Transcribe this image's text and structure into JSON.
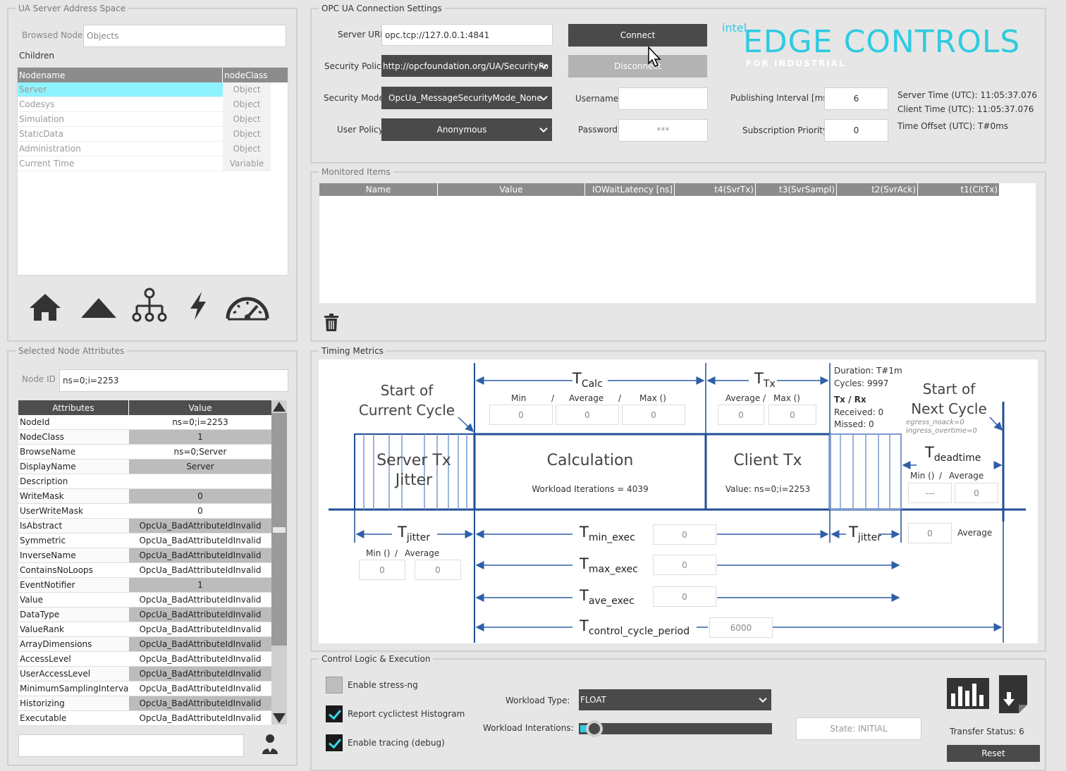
{
  "address_space": {
    "title": "UA Server Address Space",
    "browsed_node_label": "Browsed Node",
    "browsed_node_value": "Objects",
    "children_label": "Children",
    "columns": [
      "Nodename",
      "nodeClass"
    ],
    "rows": [
      {
        "name": "Server",
        "cls": "Object"
      },
      {
        "name": "Codesys",
        "cls": "Object"
      },
      {
        "name": "Simulation",
        "cls": "Object"
      },
      {
        "name": "StaticData",
        "cls": "Object"
      },
      {
        "name": "Administration",
        "cls": "Object"
      },
      {
        "name": "Current Time",
        "cls": "Variable"
      }
    ]
  },
  "attributes": {
    "title": "Selected Node Attributes",
    "node_id_label": "Node ID",
    "node_id_value": "ns=0;i=2253",
    "columns": [
      "Attributes",
      "Value"
    ],
    "rows": [
      {
        "k": "NodeId",
        "v": "ns=0;i=2253"
      },
      {
        "k": "NodeClass",
        "v": "1"
      },
      {
        "k": "BrowseName",
        "v": "ns=0;Server"
      },
      {
        "k": "DisplayName",
        "v": "Server"
      },
      {
        "k": "Description",
        "v": ""
      },
      {
        "k": "WriteMask",
        "v": "0"
      },
      {
        "k": "UserWriteMask",
        "v": "0"
      },
      {
        "k": "IsAbstract",
        "v": "OpcUa_BadAttributeIdInvalid"
      },
      {
        "k": "Symmetric",
        "v": "OpcUa_BadAttributeIdInvalid"
      },
      {
        "k": "InverseName",
        "v": "OpcUa_BadAttributeIdInvalid"
      },
      {
        "k": "ContainsNoLoops",
        "v": "OpcUa_BadAttributeIdInvalid"
      },
      {
        "k": "EventNotifier",
        "v": "1"
      },
      {
        "k": "Value",
        "v": "OpcUa_BadAttributeIdInvalid"
      },
      {
        "k": "DataType",
        "v": "OpcUa_BadAttributeIdInvalid"
      },
      {
        "k": "ValueRank",
        "v": "OpcUa_BadAttributeIdInvalid"
      },
      {
        "k": "ArrayDimensions",
        "v": "OpcUa_BadAttributeIdInvalid"
      },
      {
        "k": "AccessLevel",
        "v": "OpcUa_BadAttributeIdInvalid"
      },
      {
        "k": "UserAccessLevel",
        "v": "OpcUa_BadAttributeIdInvalid"
      },
      {
        "k": "MinimumSamplingInterval",
        "v": "OpcUa_BadAttributeIdInvalid"
      },
      {
        "k": "Historizing",
        "v": "OpcUa_BadAttributeIdInvalid"
      },
      {
        "k": "Executable",
        "v": "OpcUa_BadAttributeIdInvalid"
      }
    ]
  },
  "connection": {
    "title": "OPC UA Connection Settings",
    "server_url_label": "Server URL",
    "server_url": "opc.tcp://127.0.0.1:4841",
    "security_policy_label": "Security Policy",
    "security_policy": "http://opcfoundation.org/UA/SecurityPo",
    "security_mode_label": "Security Mode",
    "security_mode": "OpcUa_MessageSecurityMode_None",
    "user_policy_label": "User Policy",
    "user_policy": "Anonymous",
    "connect_label": "Connect",
    "disconnect_label": "Disconnect",
    "username_label": "Username",
    "username": "",
    "password_label": "Password",
    "password": "***",
    "publishing_interval_label": "Publishing Interval [ms]",
    "publishing_interval": "6",
    "subscription_priority_label": "Subscription Priority",
    "subscription_priority": "0",
    "server_time": "Server Time (UTC): 11:05:37.076",
    "client_time": "Client Time (UTC): 11:05:37.076",
    "time_offset": "Time Offset (UTC): T#0ms",
    "logo_intel": "intel",
    "logo_main": "EDGE CONTROLS",
    "logo_sub": "FOR INDUSTRIAL",
    "accent": "#2ecbe0"
  },
  "monitored": {
    "title": "Monitored Items",
    "columns": [
      "Name",
      "Value",
      "IOWaitLatency [ns]",
      "t4(SvrTx)",
      "t3(SvrSampl)",
      "t2(SvrAck)",
      "t1(CltTx)"
    ]
  },
  "timing": {
    "title": "Timing Metrics",
    "start_current": "Start of Current Cycle",
    "start_next": "Start of Next Cycle",
    "server_tx_jitter": "Server Tx Jitter",
    "calculation": "Calculation",
    "workload_iterations": "Workload Iterations = 4039",
    "client_tx": "Client Tx",
    "client_tx_value": "Value: ns=0;i=2253",
    "t_calc": "T",
    "t_calc_sub": "Calc",
    "t_tx": "T",
    "t_tx_sub": "Tx",
    "calc_min": "Min",
    "calc_avg": "Average",
    "calc_max": "Max ()",
    "slash": "/",
    "calc_vals": [
      "0",
      "0",
      "0"
    ],
    "tx_avg": "Average",
    "tx_max": "Max ()",
    "tx_vals": [
      "0",
      "0"
    ],
    "duration": "Duration: T#1m",
    "cycles": "Cycles: 9997",
    "txrx": "Tx / Rx",
    "received": "Received: 0",
    "missed": "Missed: 0",
    "egress": "egress_noack=0",
    "ingress": "ingress_overtime=0",
    "t_deadtime_sub": "deadtime",
    "dead_min": "Min ()",
    "dead_avg": "Average",
    "dead_vals": [
      "---",
      "0"
    ],
    "jitter_sub": "jitter",
    "jitter_min": "Min ()",
    "jitter_avg": "Average",
    "jitter_vals": [
      "0",
      "0"
    ],
    "jitter2_val": "0",
    "jitter2_avg": "Average",
    "min_exec_sub": "min_exec",
    "min_exec": "0",
    "max_exec_sub": "max_exec",
    "max_exec": "0",
    "ave_exec_sub": "ave_exec",
    "ave_exec": "0",
    "period_sub": "control_cycle_period",
    "period": "6000"
  },
  "control": {
    "title": "Control Logic & Execution",
    "stress": "Enable stress-ng",
    "histogram": "Report cyclictest Histogram",
    "tracing": "Enable tracing (debug)",
    "workload_type_label": "Workload Type:",
    "workload_type": "FLOAT",
    "workload_iter_label": "Workload Interations:",
    "state": "State: INITIAL",
    "transfer_status": "Transfer Status: 6",
    "reset": "Reset"
  }
}
